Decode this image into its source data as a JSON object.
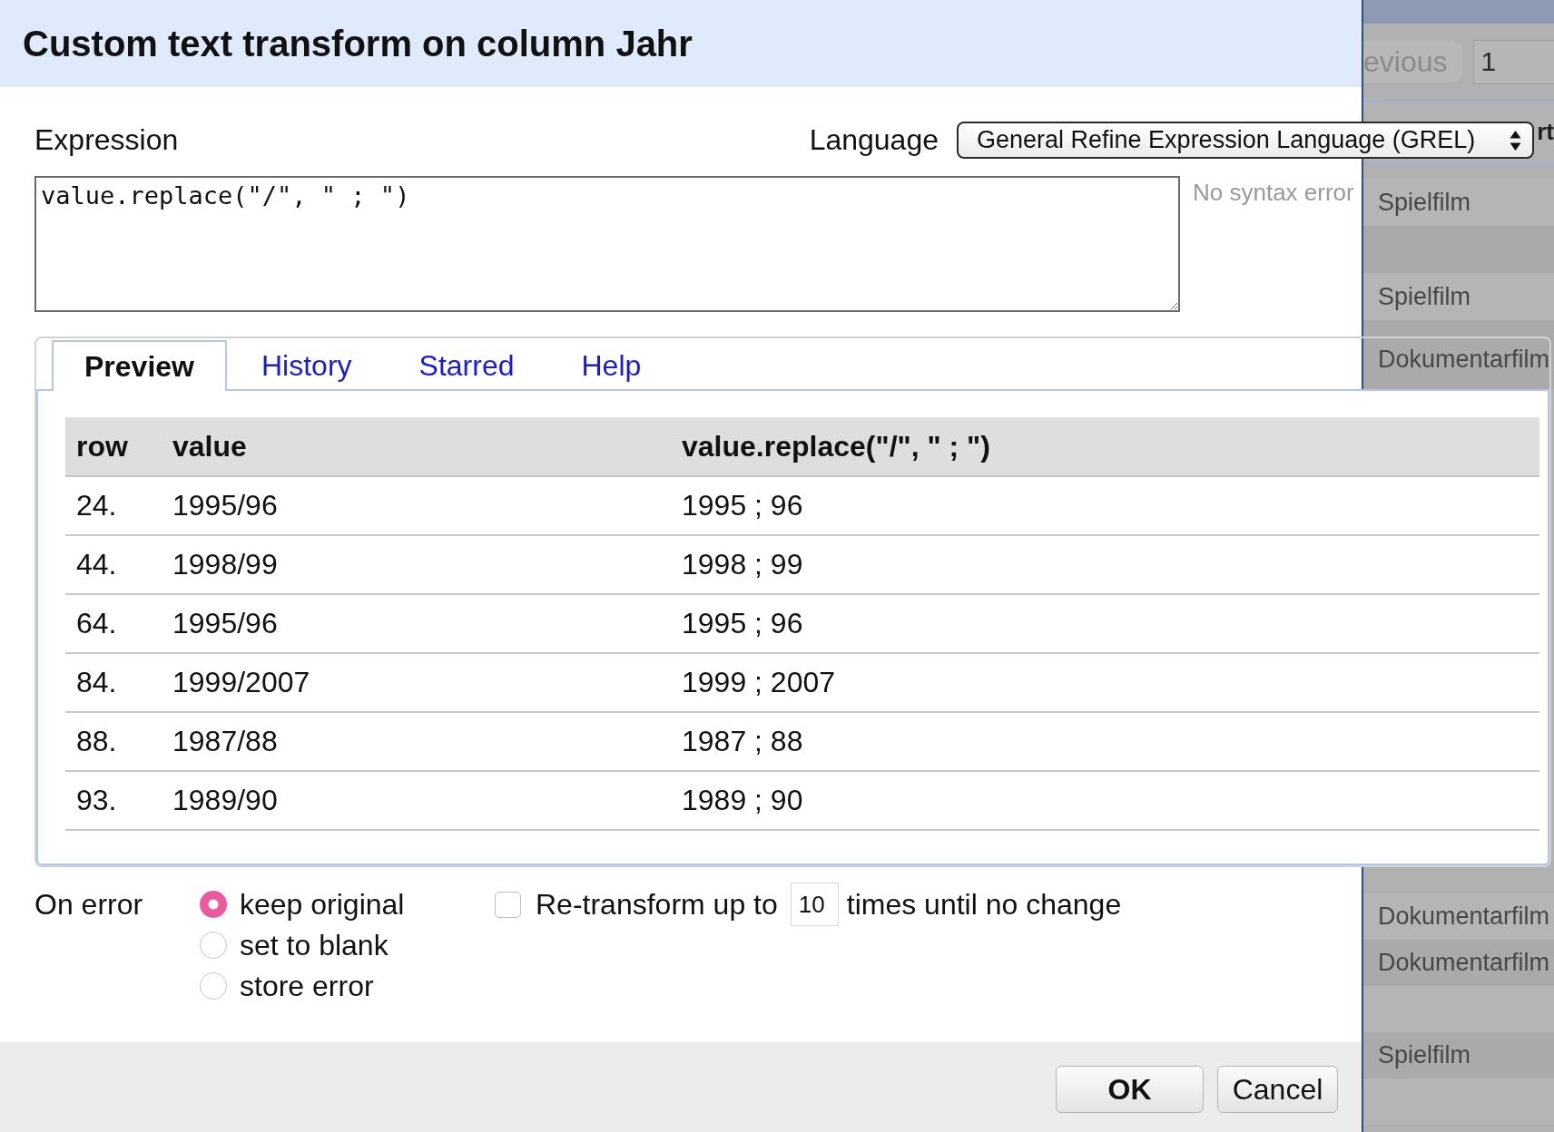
{
  "dialog": {
    "title": "Custom text transform on column Jahr"
  },
  "expression": {
    "label": "Expression",
    "value": "value.replace(\"/\", \" ; \")",
    "status": "No syntax error"
  },
  "language": {
    "label": "Language",
    "value": "General Refine Expression Language (GREL)"
  },
  "tabs": [
    {
      "label": "Preview",
      "selected": true
    },
    {
      "label": "History",
      "selected": false
    },
    {
      "label": "Starred",
      "selected": false
    },
    {
      "label": "Help",
      "selected": false
    }
  ],
  "preview_table": {
    "columns": [
      "row",
      "value",
      "value.replace(\"/\", \" ; \")"
    ],
    "rows": [
      [
        "24.",
        "1995/96",
        "1995 ; 96"
      ],
      [
        "44.",
        "1998/99",
        "1998 ; 99"
      ],
      [
        "64.",
        "1995/96",
        "1995 ; 96"
      ],
      [
        "84.",
        "1999/2007",
        "1999 ; 2007"
      ],
      [
        "88.",
        "1987/88",
        "1987 ; 88"
      ],
      [
        "93.",
        "1989/90",
        "1989 ; 90"
      ]
    ]
  },
  "on_error": {
    "label": "On error",
    "options": [
      {
        "label": "keep original",
        "selected": true
      },
      {
        "label": "set to blank",
        "selected": false
      },
      {
        "label": "store error",
        "selected": false
      }
    ]
  },
  "retransform": {
    "checked": false,
    "label": "Re-transform up to",
    "value": "10",
    "suffix": "times until no change"
  },
  "buttons": [
    {
      "label": "OK",
      "kind": "primary"
    },
    {
      "label": "Cancel",
      "kind": "secondary"
    }
  ],
  "background_page": {
    "pager_button": "evious",
    "page_field": "1",
    "header_fragment": "rt",
    "rows_top": [
      {
        "kind": "text",
        "cell": "Spielfilm"
      },
      {
        "kind": "blank"
      },
      {
        "kind": "text",
        "cell": "Spielfilm"
      },
      {
        "kind": "text",
        "cell": "Dokumentarfilm"
      }
    ],
    "rows_bottom": [
      {
        "kind": "text",
        "cell": "Dokumentarfilm"
      },
      {
        "kind": "text",
        "cell": "Dokumentarfilm"
      },
      {
        "kind": "blank"
      },
      {
        "kind": "text",
        "cell": "Spielfilm"
      },
      {
        "kind": "blank"
      }
    ]
  }
}
